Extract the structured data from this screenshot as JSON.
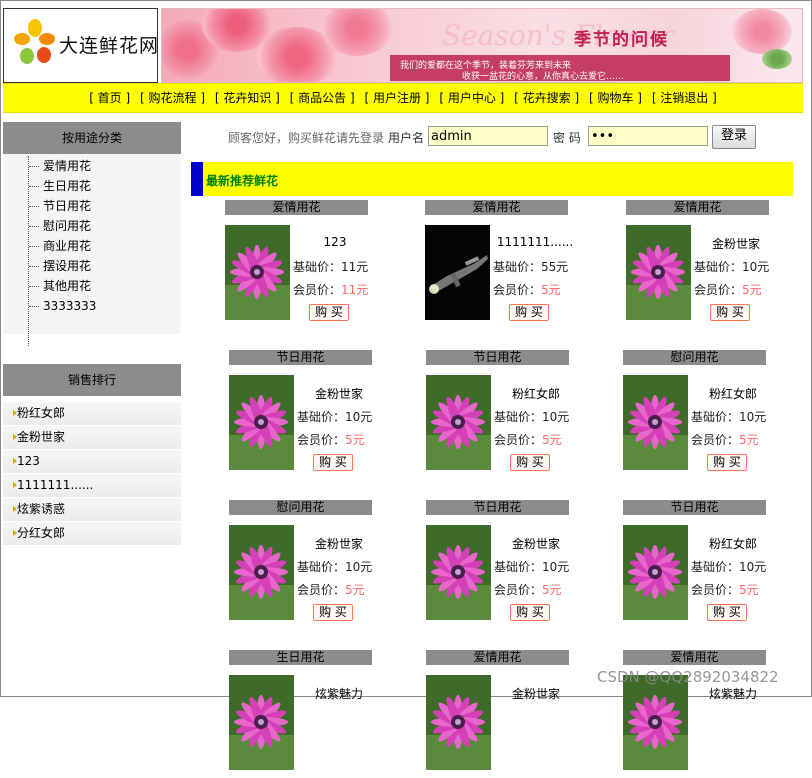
{
  "header": {
    "logo_text": "大连鲜花网",
    "banner_title_en": "Season's Flower",
    "banner_title_cn": "季节的问候",
    "banner_line1": "我们的爱都在这个季节，装着芬芳来到未来",
    "banner_line2": "收获一盆花的心意，从你真心去爱它……"
  },
  "nav": {
    "items": [
      "[ 首页 ]",
      "[ 购花流程 ]",
      "[ 花卉知识 ]",
      "[ 商品公告 ]",
      "[ 用户注册 ]",
      "[ 用户中心 ]",
      "[ 花卉搜索 ]",
      "[ 购物车 ]",
      "[ 注销退出 ]"
    ]
  },
  "sidebar": {
    "category_title": "按用途分类",
    "categories": [
      "爱情用花",
      "生日用花",
      "节日用花",
      "慰问用花",
      "商业用花",
      "摆设用花",
      "其他用花",
      "3333333"
    ],
    "ranking_title": "销售排行",
    "ranking": [
      "粉红女郎",
      "金粉世家",
      "123",
      "1111111......",
      "炫紫诱惑",
      "分红女郎"
    ]
  },
  "login": {
    "greeting": "顾客您好，购买鲜花请先登录",
    "username_label": "用户名",
    "username_value": "admin",
    "password_label": "密  码",
    "password_value": "•••",
    "login_button": "登录"
  },
  "section": {
    "title": "最新推荐鲜花"
  },
  "labels": {
    "base_price": "基础价：",
    "member_price": "会员价：",
    "buy": "购 买"
  },
  "products": [
    {
      "category": "爱情用花",
      "name": "123",
      "base": "11元",
      "member": "11元",
      "image": "flower"
    },
    {
      "category": "爱情用花",
      "name": "1111111......",
      "base": "55元",
      "member": "5元",
      "image": "gun"
    },
    {
      "category": "爱情用花",
      "name": "金粉世家",
      "base": "10元",
      "member": "5元",
      "image": "flower"
    },
    {
      "category": "节日用花",
      "name": "金粉世家",
      "base": "10元",
      "member": "5元",
      "image": "flower"
    },
    {
      "category": "节日用花",
      "name": "粉红女郎",
      "base": "10元",
      "member": "5元",
      "image": "flower"
    },
    {
      "category": "慰问用花",
      "name": "粉红女郎",
      "base": "10元",
      "member": "5元",
      "image": "flower"
    },
    {
      "category": "慰问用花",
      "name": "金粉世家",
      "base": "10元",
      "member": "5元",
      "image": "flower"
    },
    {
      "category": "节日用花",
      "name": "金粉世家",
      "base": "10元",
      "member": "5元",
      "image": "flower"
    },
    {
      "category": "节日用花",
      "name": "粉红女郎",
      "base": "10元",
      "member": "5元",
      "image": "flower"
    },
    {
      "category": "生日用花",
      "name": "炫紫魅力",
      "base": "",
      "member": "",
      "image": "flower"
    },
    {
      "category": "爱情用花",
      "name": "金粉世家",
      "base": "",
      "member": "",
      "image": "flower"
    },
    {
      "category": "爱情用花",
      "name": "炫紫魅力",
      "base": "",
      "member": "",
      "image": "flower"
    }
  ],
  "watermark": "CSDN @QQ2892034822"
}
